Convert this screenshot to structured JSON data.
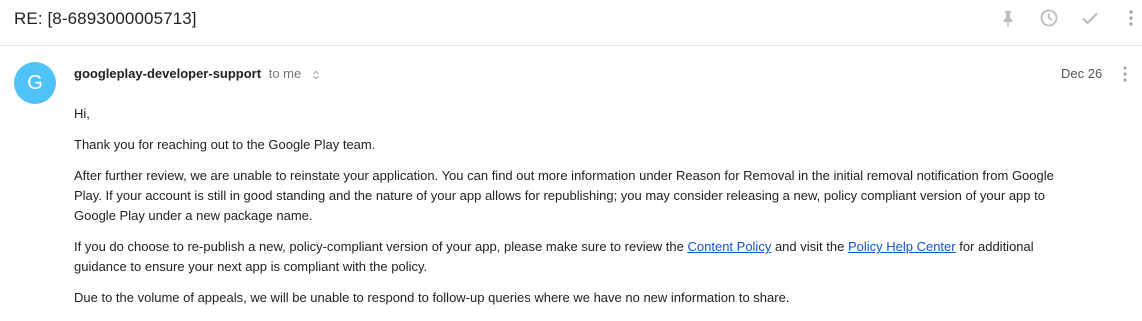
{
  "email": {
    "subject": "RE: [8-6893000005713]"
  },
  "toolbar": {
    "icons": [
      "pin-icon",
      "clock-icon",
      "check-icon",
      "more-vert-icon"
    ]
  },
  "message": {
    "avatar_letter": "G",
    "avatar_color": "#4fc3f7",
    "sender": "googleplay-developer-support",
    "recipient": "to me",
    "date": "Dec 26",
    "greeting": "Hi,",
    "para1": "Thank you for reaching out to the Google Play team.",
    "para2": "After further review, we are unable to reinstate your application. You can find out more information under Reason for Removal in the initial removal notification from Google Play. If your account is still in good standing and the nature of your app allows for republishing; you may consider releasing a new, policy compliant version of your app to Google Play under a new package name.",
    "para3_a": "If you do choose to re-publish a new, policy-compliant version of your app, please make sure to review the ",
    "link_content_policy": "Content Policy",
    "para3_b": " and visit the ",
    "link_help_center": "Policy Help Center",
    "para3_c": " for additional guidance to ensure your next app is compliant with the policy.",
    "para4": "Due to the volume of appeals, we will be unable to respond to follow-up queries where we have no new information to share."
  },
  "colors": {
    "link": "#1155cc",
    "icon_gray": "#bdbdbd"
  }
}
